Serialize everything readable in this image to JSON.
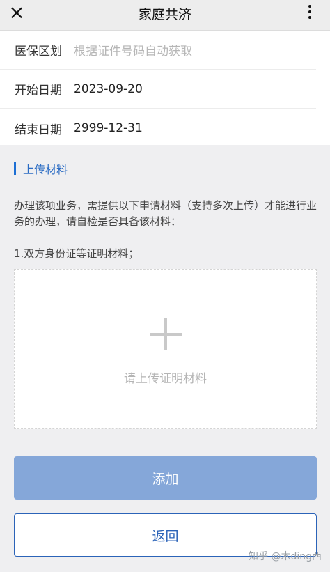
{
  "header": {
    "title": "家庭共济",
    "close_icon": "×"
  },
  "form": {
    "rows": [
      {
        "label": "医保区划",
        "value": "根据证件号码自动获取",
        "is_placeholder": true
      },
      {
        "label": "开始日期",
        "value": "2023-09-20"
      },
      {
        "label": "结束日期",
        "value": "2999-12-31"
      }
    ]
  },
  "upload_section": {
    "title": "上传材料",
    "description": "办理该项业务，需提供以下申请材料（支持多次上传）才能进行业务的办理，请自检是否具备该材料：",
    "item_title": "1.双方身份证等证明材料；",
    "upload_hint": "请上传证明材料"
  },
  "buttons": {
    "add": "添加",
    "back": "返回"
  },
  "watermark": "知乎 @木ding西",
  "colors": {
    "accent": "#2b6cc4",
    "add_button": "#85a7d9",
    "section_bg": "#efeff1"
  }
}
